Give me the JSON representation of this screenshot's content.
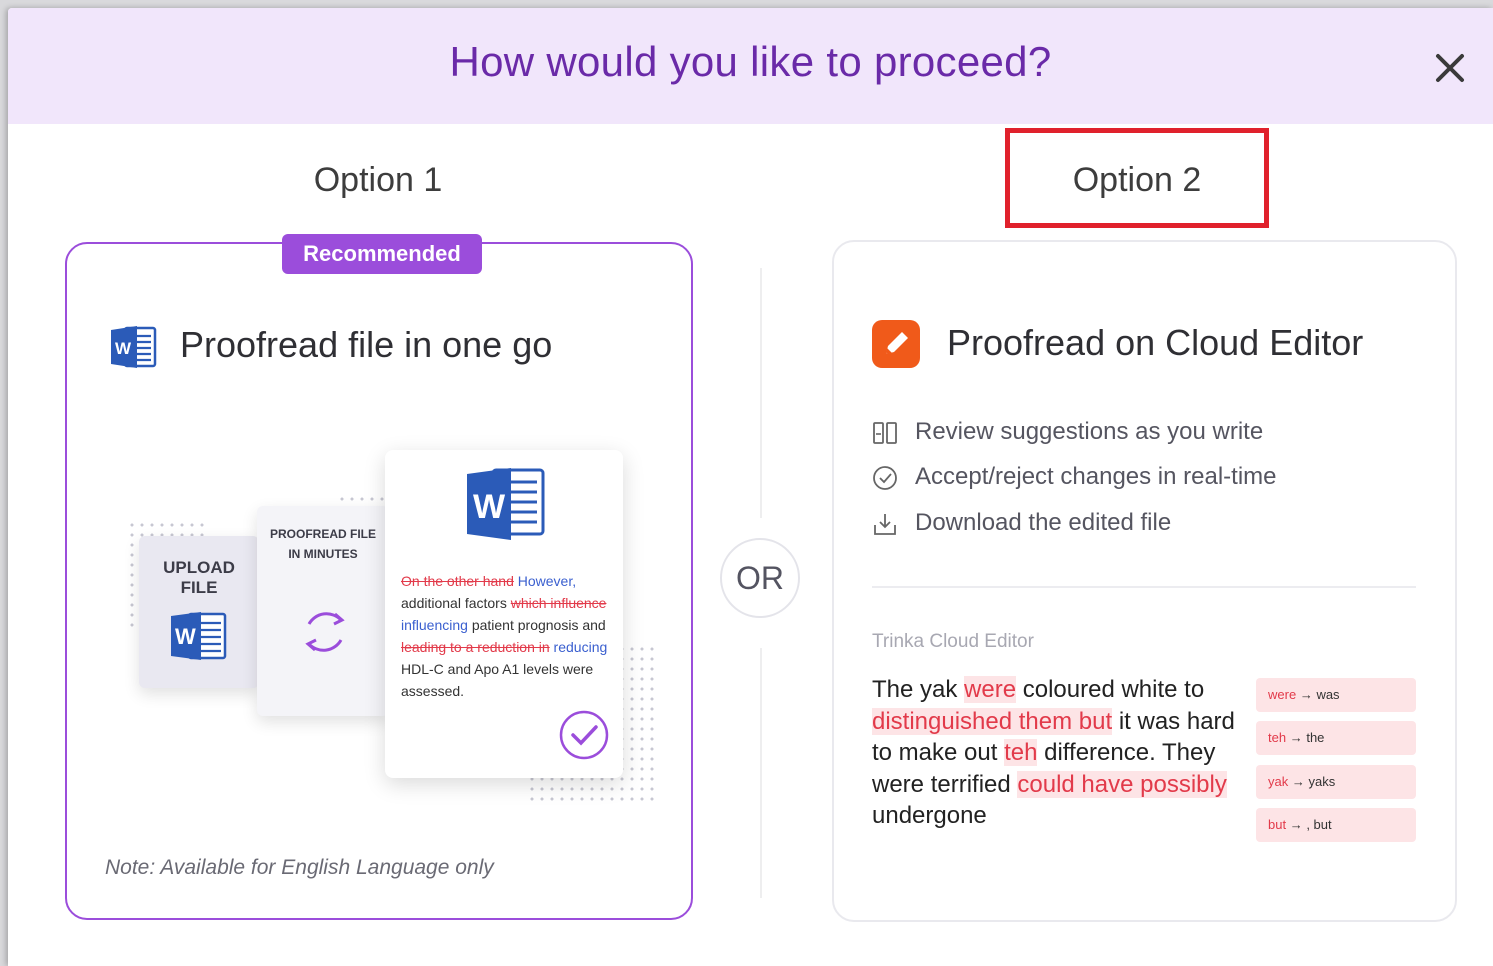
{
  "header": {
    "title": "How would you like to proceed?"
  },
  "options": {
    "option1_label": "Option 1",
    "option2_label": "Option 2"
  },
  "card1": {
    "badge": "Recommended",
    "title": "Proofread file in one go",
    "illustration": {
      "upload_line1": "UPLOAD",
      "upload_line2": "FILE",
      "proofread_line1": "PROOFREAD FILE",
      "proofread_line2": "IN MINUTES",
      "doc_segments": {
        "s1_del": "On the other hand",
        "s1_ins": " However,",
        "s2": " additional factors ",
        "s3_del": "which influence",
        "s3_ins": " influencing",
        "s4": " patient prognosis and ",
        "s5_del": "leading to a reduction in",
        "s5_ins": " reducing",
        "s6": " HDL-C and Apo A1 levels were assessed."
      }
    },
    "note": "Note: Available for English Language only"
  },
  "divider": {
    "or_label": "OR"
  },
  "card2": {
    "title": "Proofread on Cloud Editor",
    "features": [
      {
        "icon": "review-icon",
        "text": "Review suggestions as you write"
      },
      {
        "icon": "check-circle-icon",
        "text": "Accept/reject changes in real-time"
      },
      {
        "icon": "download-icon",
        "text": "Download the edited file"
      }
    ],
    "editor_label": "Trinka Cloud Editor",
    "editor_text": {
      "t1": "The yak ",
      "h1": "were",
      "t2": " coloured white to ",
      "h2": "distinguished them but",
      "t3": " it was hard to make out ",
      "h3": "teh",
      "t4": " difference. They were terrified ",
      "h4": "could have possibly",
      "t5": " undergone"
    },
    "suggestions": [
      {
        "from": "were",
        "to": "was"
      },
      {
        "from": "teh",
        "to": "the"
      },
      {
        "from": "yak",
        "to": "yaks"
      },
      {
        "from": "but",
        "to": ", but"
      }
    ]
  },
  "colors": {
    "accent": "#9b4ddb",
    "title": "#6a2aa8",
    "highlight_box": "#e0212c",
    "error": "#e23a4a",
    "insert": "#3a5fcf"
  }
}
